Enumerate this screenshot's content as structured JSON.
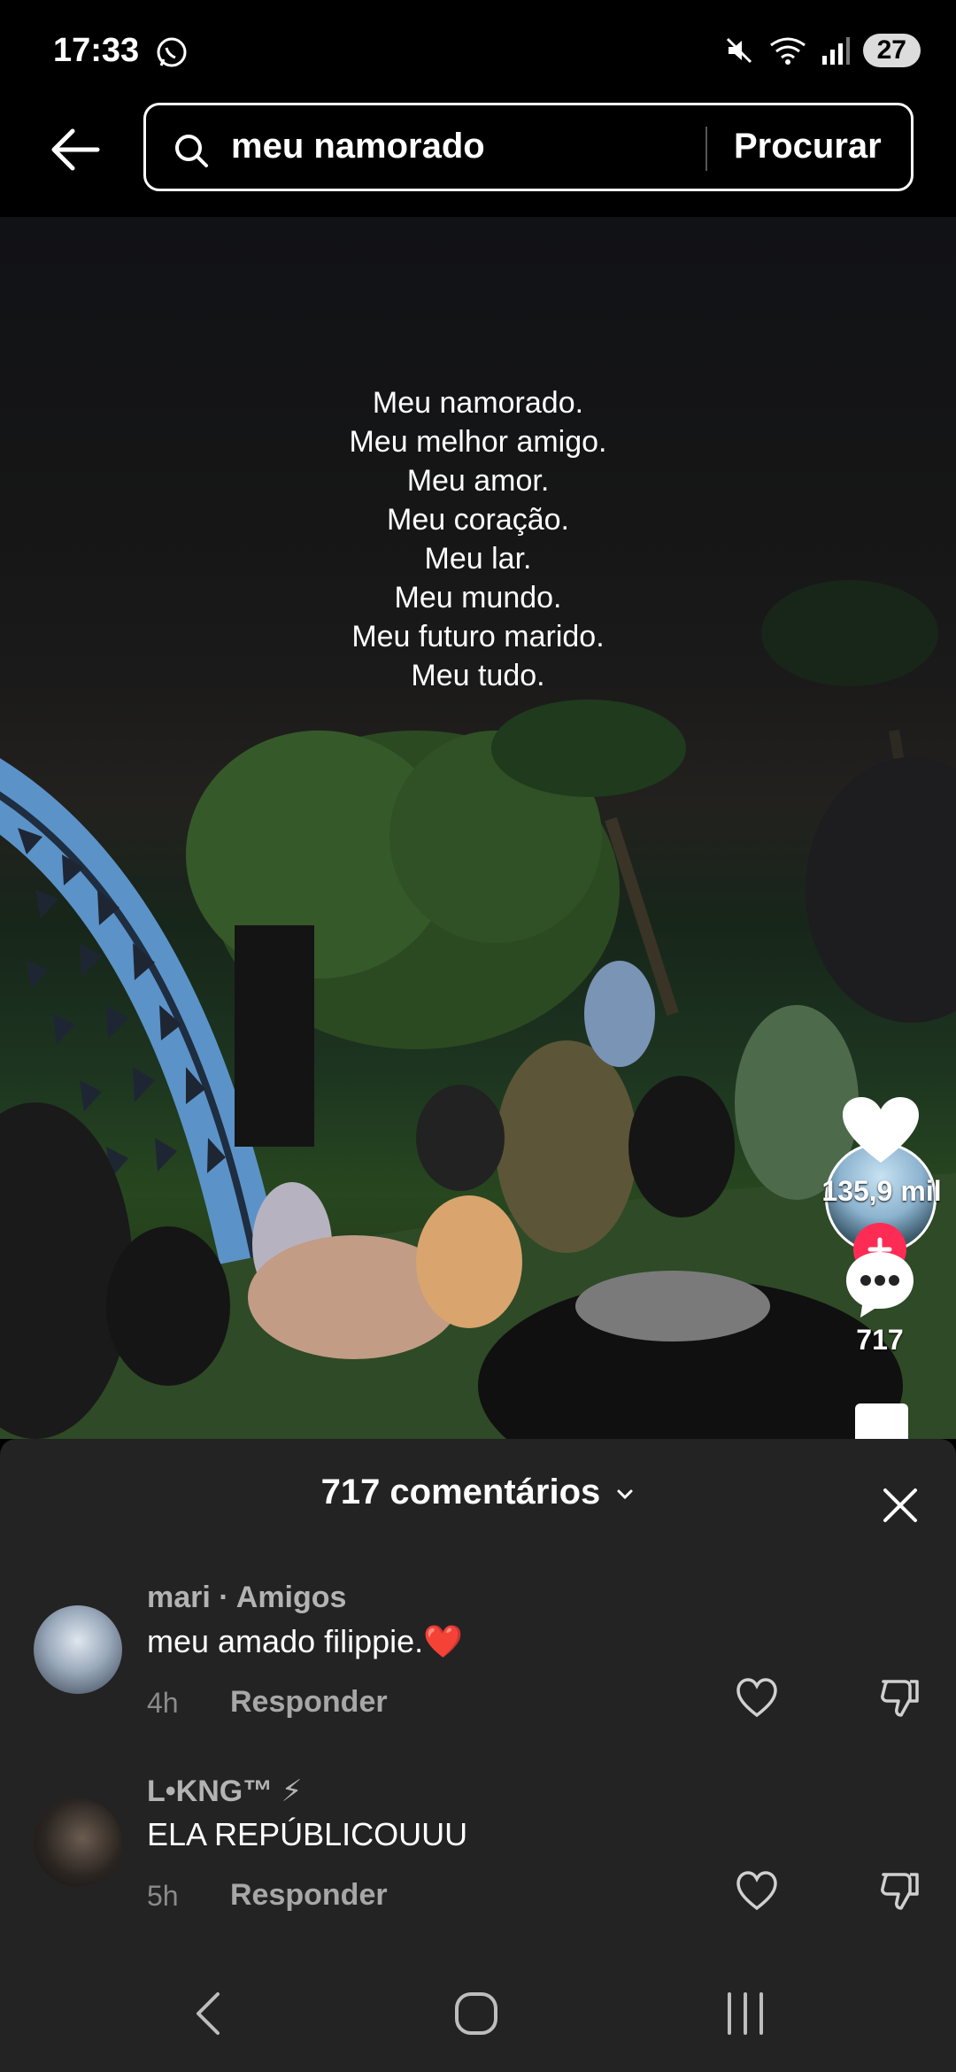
{
  "status_bar": {
    "time": "17:33",
    "battery": "27",
    "icons": [
      "whatsapp-icon",
      "mute-icon",
      "wifi-icon",
      "signal-icon"
    ]
  },
  "search": {
    "query": "meu namorado",
    "button_label": "Procurar"
  },
  "video": {
    "overlay_lines": [
      "Meu namorado.",
      "Meu melhor amigo.",
      "Meu amor.",
      "Meu coração.",
      "Meu lar.",
      "Meu mundo.",
      "Meu futuro marido.",
      "Meu tudo."
    ],
    "likes": "135,9 mil",
    "comments": "717"
  },
  "comments_panel": {
    "title": "717 comentários",
    "items": [
      {
        "user": "mari · Amigos",
        "text": "meu amado filippie.",
        "emoji": "❤️",
        "time": "4h",
        "reply_label": "Responder"
      },
      {
        "user": "L•KNG™ ⚡",
        "text": "ELA REPÚBLICOUUU",
        "time": "5h",
        "reply_label": "Responder"
      }
    ]
  },
  "colors": {
    "accent": "#fe2c55",
    "sheet_bg": "#232323"
  }
}
